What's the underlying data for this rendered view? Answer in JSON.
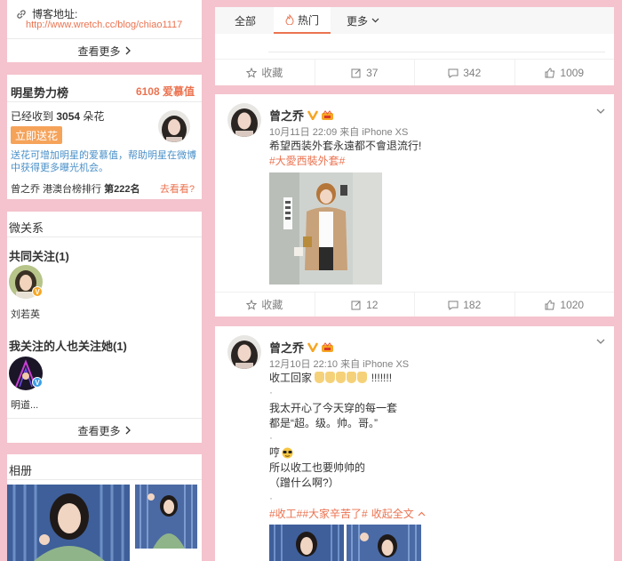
{
  "blog": {
    "label": "博客地址:",
    "url": "http://www.wretch.cc/blog/chiao1117",
    "more": "查看更多"
  },
  "star": {
    "title": "明星势力榜",
    "score": "6108",
    "score_unit": "爱慕值",
    "received_prefix": "已经收到",
    "received_count": "3054",
    "received_suffix": "朵花",
    "send_button": "立即送花",
    "desc": "送花可增加明星的爱慕值，帮助明星在微博中获得更多曝光机会。",
    "rank_name": "曾之乔",
    "rank_board": "港澳台榜排行",
    "rank_value": "第222名",
    "rank_link": "去看看?"
  },
  "relations": {
    "title": "微关系",
    "mutual_title": "共同关注(1)",
    "mutual_user": "刘若英",
    "follow_title": "我关注的人也关注她(1)",
    "follow_user": "明道...",
    "more": "查看更多"
  },
  "album": {
    "title": "相册"
  },
  "tabs": {
    "all": "全部",
    "hot": "热门",
    "more": "更多"
  },
  "post0": {
    "actions": {
      "fav": "收藏",
      "repost": "37",
      "comment": "342",
      "like": "1009"
    }
  },
  "post1": {
    "name": "曾之乔",
    "meta": "10月11日 22:09 来自 iPhone XS",
    "text": "希望西装外套永遠都不會退流行!",
    "tag": "#大愛西裝外套#",
    "actions": {
      "fav": "收藏",
      "repost": "12",
      "comment": "182",
      "like": "1020"
    }
  },
  "post2": {
    "name": "曾之乔",
    "meta": "12月10日 22:10 来自 iPhone XS",
    "line1": "收工回家",
    "line1_tail": "!!!!!!!",
    "dot1": "·",
    "line2": "我太开心了今天穿的每一套",
    "line3": "都是“超。级。帅。哥。”",
    "dot2": "·",
    "line4": "哼",
    "line5": "所以收工也要帅帅的",
    "line6": "（蹭什么啊?）",
    "dot3": "·",
    "tags": "#收工##大家辛苦了#",
    "collapse": "收起全文"
  },
  "colors": {
    "accent": "#eb7350",
    "page_bg": "#f4c3cd",
    "verify_orange": "#f6a623",
    "verify_blue": "#3b9fe8"
  }
}
